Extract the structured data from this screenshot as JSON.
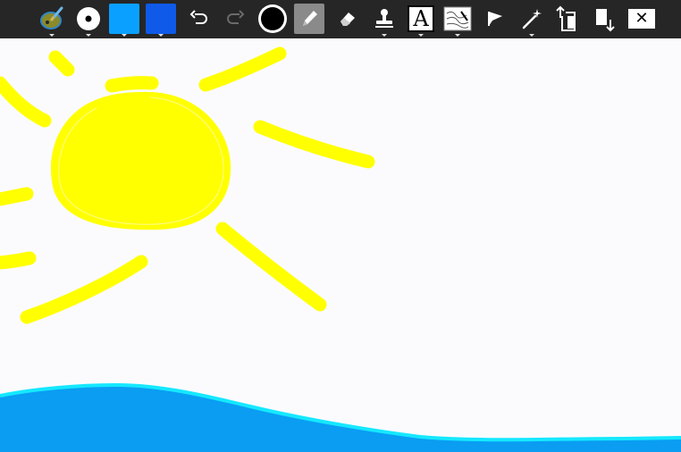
{
  "toolbar": {
    "tools": [
      {
        "id": "palette",
        "icon": "palette-icon",
        "has_menu": true
      },
      {
        "id": "brush-size",
        "icon": "brush-size-icon",
        "has_menu": true
      },
      {
        "id": "primary-color",
        "icon": "primary-color-swatch",
        "color": "#0aa0ff",
        "has_menu": true
      },
      {
        "id": "secondary-color",
        "icon": "secondary-color-swatch",
        "color": "#0f5ae8",
        "has_menu": true
      },
      {
        "id": "undo",
        "icon": "undo-icon",
        "has_menu": false
      },
      {
        "id": "redo",
        "icon": "redo-icon",
        "has_menu": false
      },
      {
        "id": "brush-color",
        "icon": "color-circle-icon",
        "color": "#000000",
        "has_menu": false
      },
      {
        "id": "pencil",
        "icon": "pencil-icon",
        "has_menu": false,
        "active": true
      },
      {
        "id": "eraser",
        "icon": "eraser-icon",
        "has_menu": false
      },
      {
        "id": "stamp",
        "icon": "stamp-icon",
        "has_menu": true
      },
      {
        "id": "text",
        "icon": "text-icon",
        "glyph": "A",
        "has_menu": true
      },
      {
        "id": "background",
        "icon": "background-icon",
        "has_menu": true
      },
      {
        "id": "fill",
        "icon": "fill-bucket-icon",
        "has_menu": false
      },
      {
        "id": "magic",
        "icon": "magic-wand-icon",
        "has_menu": true
      },
      {
        "id": "upload",
        "icon": "upload-icon",
        "has_menu": false
      },
      {
        "id": "download",
        "icon": "download-icon",
        "has_menu": false
      },
      {
        "id": "close",
        "icon": "close-icon",
        "glyph": "✕",
        "has_menu": false
      }
    ]
  },
  "colors": {
    "toolbar_bg": "#262626",
    "canvas_bg": "#fbfbfe",
    "sun": "#ffff00",
    "sea": "#0a9df2",
    "sea_edge": "#15e8ff",
    "primary": "#0aa0ff",
    "secondary": "#0f5ae8"
  }
}
